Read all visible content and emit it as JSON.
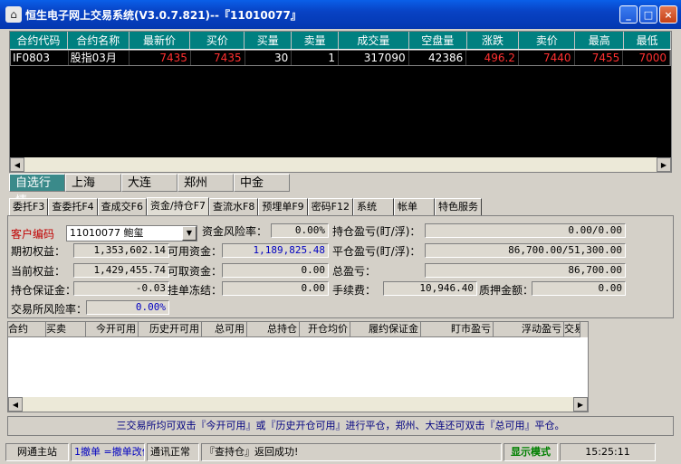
{
  "window": {
    "title": "恒生电子网上交易系统(V3.0.7.821)--『11010077』",
    "minimize": "_",
    "maximize": "□",
    "close": "×"
  },
  "quote_table": {
    "headers": [
      "合约代码",
      "合约名称",
      "最新价",
      "买价",
      "买量",
      "卖量",
      "成交量",
      "空盘量",
      "涨跌",
      "卖价",
      "最高",
      "最低"
    ],
    "rows": [
      [
        "IF0803",
        "股指03月",
        "7435",
        "7435",
        "30",
        "1",
        "317090",
        "42386",
        "496.2",
        "7440",
        "7455",
        "7000"
      ]
    ]
  },
  "market_tabs": [
    "自选行情",
    "上海",
    "大连",
    "郑州",
    "中金"
  ],
  "function_tabs": [
    "委托F3",
    "查委托F4",
    "查成交F6",
    "资金/持仓F7",
    "查流水F8",
    "预埋单F9",
    "密码F12",
    "系统",
    "帐单",
    "特色服务"
  ],
  "account": {
    "client_code_label": "客户编码",
    "client_code_value": "11010077 鲍玺",
    "risk_label": "资金风险率：",
    "risk_value": "0.00%",
    "pos_pnl_label": "持仓盈亏(盯/浮)：",
    "pos_pnl_value": "0.00/0.00",
    "init_equity_label": "期初权益：",
    "init_equity_value": "1,353,602.14",
    "avail_label": "可用资金：",
    "avail_value": "1,189,825.48",
    "close_pnl_label": "平仓盈亏(盯/浮)：",
    "close_pnl_value": "86,700.00/51,300.00",
    "cur_equity_label": "当前权益：",
    "cur_equity_value": "1,429,455.74",
    "withdraw_label": "可取资金：",
    "withdraw_value": "0.00",
    "total_pnl_label": "总盈亏：",
    "total_pnl_value": "86,700.00",
    "margin_label": "持仓保证金：",
    "margin_value": "-0.03",
    "frozen_label": "挂单冻结：",
    "frozen_value": "0.00",
    "fee_label": "手续费：",
    "fee_value": "10,946.40",
    "pledge_label": "质押金额：",
    "pledge_value": "0.00",
    "exch_risk_label": "交易所风险率：",
    "exch_risk_value": "0.00%"
  },
  "position_grid": {
    "headers": [
      "合约",
      "买卖",
      "今开可用",
      "历史开可用",
      "总可用",
      "总持仓",
      "开仓均价",
      "履约保证金",
      "盯市盈亏",
      "浮动盈亏",
      "交易"
    ]
  },
  "hint": "三交易所均可双击『今开可用』或『历史开仓可用』进行平仓，郑州、大连还可双击『总可用』平仓。",
  "status": {
    "station": "网通主站",
    "cancel": "1撤单 =撤单改价",
    "comm": "通讯正常",
    "msg": "『查持仓』返回成功!",
    "mode": "显示模式",
    "time": "15:25:11"
  }
}
